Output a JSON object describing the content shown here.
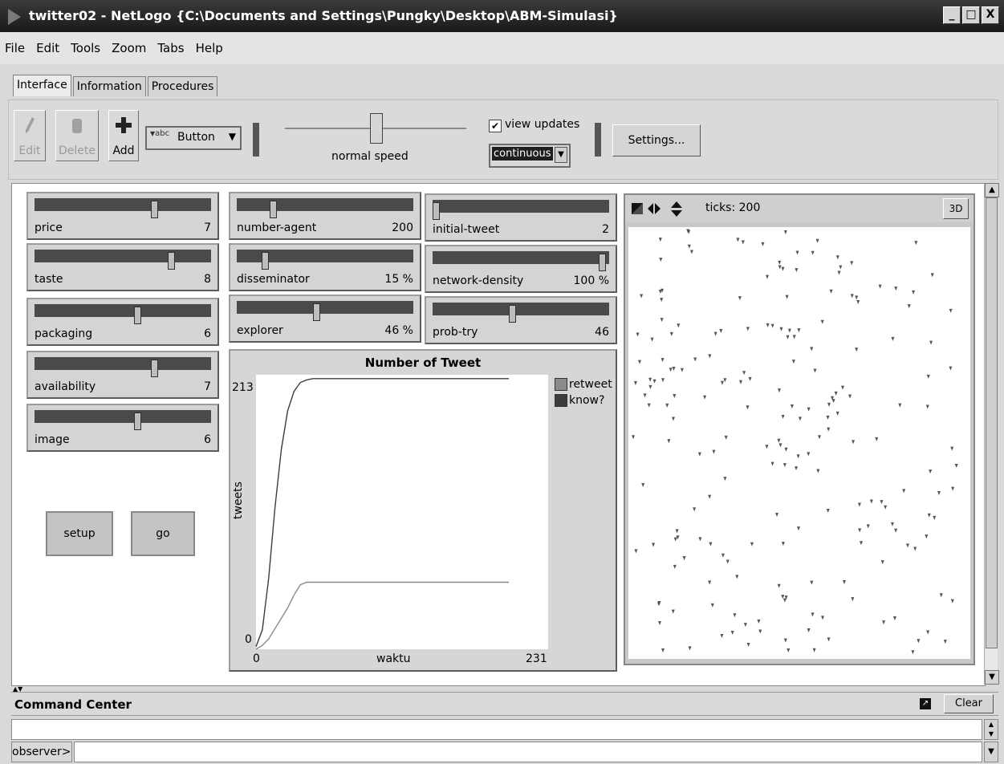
{
  "window": {
    "title": "twitter02 - NetLogo {C:\\Documents and Settings\\Pungky\\Desktop\\ABM-Simulasi}",
    "controls": [
      "_",
      "□",
      "X"
    ]
  },
  "menu": [
    "File",
    "Edit",
    "Tools",
    "Zoom",
    "Tabs",
    "Help"
  ],
  "tabs": [
    "Interface",
    "Information",
    "Procedures"
  ],
  "toolbar": {
    "edit_label": "Edit",
    "delete_label": "Delete",
    "add_label": "Add",
    "widget_type": "Button",
    "widget_type_prefix": "abc",
    "speed_label": "normal speed",
    "speed_value": 0.5,
    "view_updates_label": "view updates",
    "view_updates_checked": true,
    "update_mode": "continuous",
    "settings_label": "Settings..."
  },
  "sliders": [
    {
      "name": "price",
      "value": "7",
      "fraction": 0.7
    },
    {
      "name": "taste",
      "value": "8",
      "fraction": 0.8
    },
    {
      "name": "packaging",
      "value": "6",
      "fraction": 0.6
    },
    {
      "name": "availability",
      "value": "7",
      "fraction": 0.7
    },
    {
      "name": "image",
      "value": "6",
      "fraction": 0.6
    },
    {
      "name": "number-agent",
      "value": "200",
      "fraction": 0.2
    },
    {
      "name": "disseminator",
      "value": "15 %",
      "fraction": 0.15
    },
    {
      "name": "explorer",
      "value": "46 %",
      "fraction": 0.46
    },
    {
      "name": "initial-tweet",
      "value": "2",
      "fraction": 0.0
    },
    {
      "name": "network-density",
      "value": "100 %",
      "fraction": 1.0
    },
    {
      "name": "prob-try",
      "value": "46",
      "fraction": 0.46
    }
  ],
  "buttons": {
    "setup": "setup",
    "go": "go"
  },
  "plot": {
    "title": "Number of Tweet",
    "xlabel": "waktu",
    "ylabel": "tweets",
    "xmin": "0",
    "xmax": "231",
    "ymin": "0",
    "ymax": "213",
    "legend": [
      {
        "name": "retweet",
        "color": "#8a8a8a"
      },
      {
        "name": "know?",
        "color": "#3c3c3c"
      }
    ]
  },
  "chart_data": {
    "type": "line",
    "title": "Number of Tweet",
    "xlabel": "waktu",
    "ylabel": "tweets",
    "xlim": [
      0,
      231
    ],
    "ylim": [
      0,
      213
    ],
    "series": [
      {
        "name": "know?",
        "x": [
          0,
          5,
          10,
          15,
          20,
          25,
          30,
          35,
          40,
          45,
          50,
          60,
          80,
          120,
          200
        ],
        "values": [
          2,
          15,
          55,
          110,
          155,
          185,
          200,
          207,
          209,
          210,
          210,
          210,
          210,
          210,
          210
        ]
      },
      {
        "name": "retweet",
        "x": [
          0,
          5,
          10,
          15,
          20,
          25,
          30,
          35,
          40,
          45,
          50,
          60,
          80,
          120,
          200
        ],
        "values": [
          0,
          3,
          8,
          16,
          24,
          32,
          42,
          50,
          52,
          52,
          52,
          52,
          52,
          52,
          52
        ]
      }
    ]
  },
  "view": {
    "ticks_label": "ticks: 200",
    "threed_label": "3D"
  },
  "command_center": {
    "title": "Command Center",
    "clear_label": "Clear",
    "prompt": "observer>"
  }
}
